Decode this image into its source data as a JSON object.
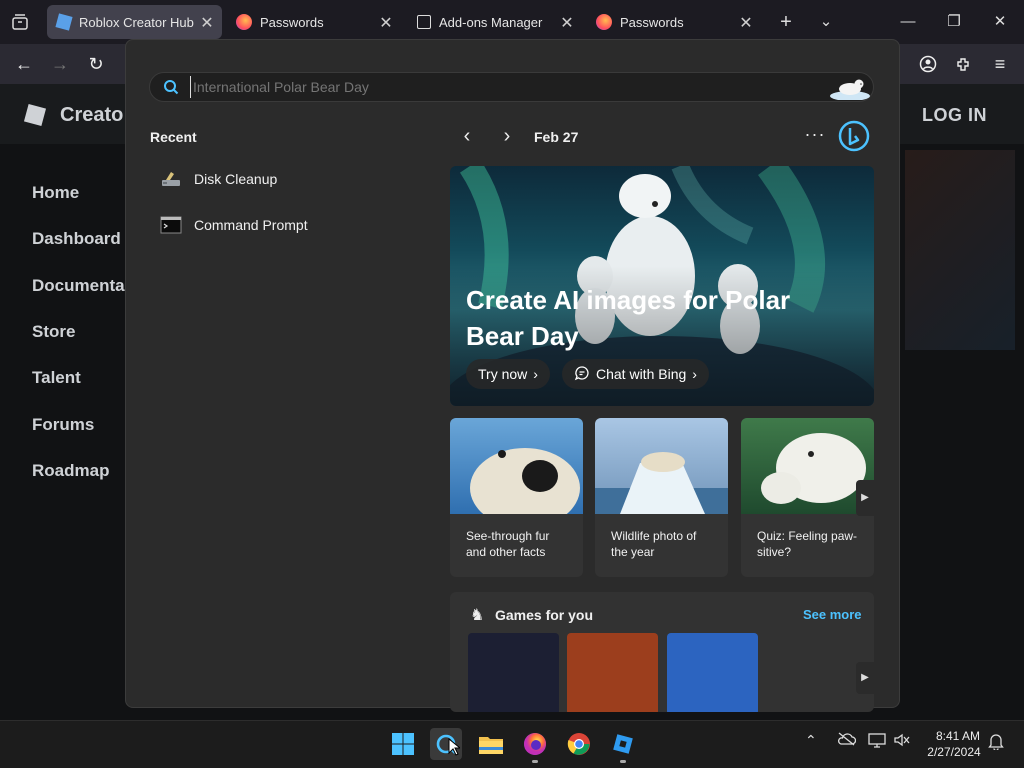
{
  "browser": {
    "tabs": [
      {
        "title": "Roblox Creator Hub",
        "active": true
      },
      {
        "title": "Passwords",
        "active": false
      },
      {
        "title": "Add-ons Manager",
        "active": false
      },
      {
        "title": "Passwords",
        "active": false
      }
    ]
  },
  "site": {
    "brand": "Creato",
    "login": "LOG IN",
    "nav": [
      "Home",
      "Dashboard",
      "Documenta",
      "Store",
      "Talent",
      "Forums",
      "Roadmap"
    ]
  },
  "search": {
    "placeholder": "International Polar Bear Day",
    "recent_heading": "Recent",
    "recent": [
      {
        "label": "Disk Cleanup",
        "icon": "disk-cleanup-icon"
      },
      {
        "label": "Command Prompt",
        "icon": "command-prompt-icon"
      }
    ],
    "date": "Feb 27",
    "hero": {
      "title": "Create AI images for Polar Bear Day",
      "try_label": "Try now",
      "chat_label": "Chat with Bing"
    },
    "cards": [
      {
        "caption": "See-through fur and other facts"
      },
      {
        "caption": "Wildlife photo of the year"
      },
      {
        "caption": "Quiz: Feeling paw-sitive?"
      }
    ],
    "games": {
      "heading": "Games for you",
      "see_more": "See more",
      "tile_colors": [
        "#1c1f33",
        "#9c3e1d",
        "#2c64c0"
      ]
    }
  },
  "taskbar": {
    "time": "8:41 AM",
    "date": "2/27/2024"
  },
  "colors": {
    "accent_link": "#4cc2ff",
    "flyout_bg": "#2b2b2b"
  }
}
